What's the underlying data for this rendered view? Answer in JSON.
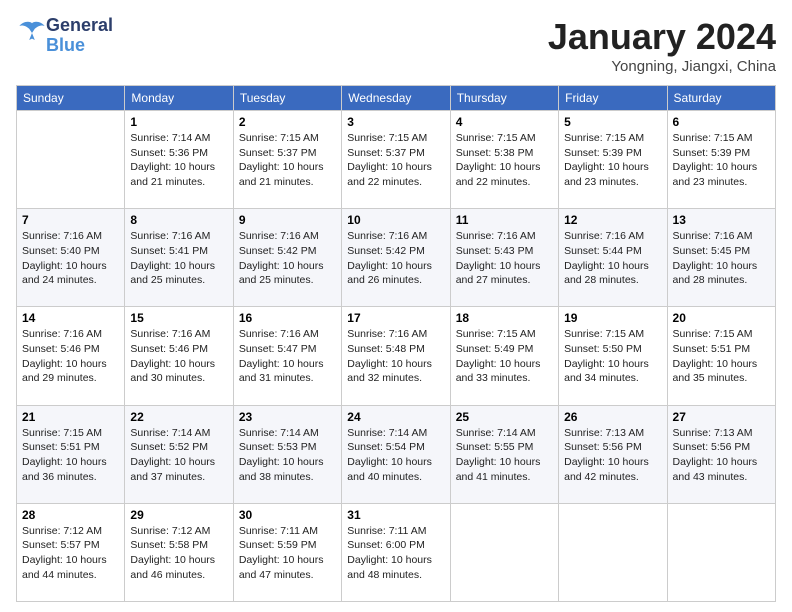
{
  "header": {
    "logo_line1": "General",
    "logo_line2": "Blue",
    "month_title": "January 2024",
    "location": "Yongning, Jiangxi, China"
  },
  "days_of_week": [
    "Sunday",
    "Monday",
    "Tuesday",
    "Wednesday",
    "Thursday",
    "Friday",
    "Saturday"
  ],
  "weeks": [
    [
      {
        "day": "",
        "info": ""
      },
      {
        "day": "1",
        "info": "Sunrise: 7:14 AM\nSunset: 5:36 PM\nDaylight: 10 hours\nand 21 minutes."
      },
      {
        "day": "2",
        "info": "Sunrise: 7:15 AM\nSunset: 5:37 PM\nDaylight: 10 hours\nand 21 minutes."
      },
      {
        "day": "3",
        "info": "Sunrise: 7:15 AM\nSunset: 5:37 PM\nDaylight: 10 hours\nand 22 minutes."
      },
      {
        "day": "4",
        "info": "Sunrise: 7:15 AM\nSunset: 5:38 PM\nDaylight: 10 hours\nand 22 minutes."
      },
      {
        "day": "5",
        "info": "Sunrise: 7:15 AM\nSunset: 5:39 PM\nDaylight: 10 hours\nand 23 minutes."
      },
      {
        "day": "6",
        "info": "Sunrise: 7:15 AM\nSunset: 5:39 PM\nDaylight: 10 hours\nand 23 minutes."
      }
    ],
    [
      {
        "day": "7",
        "info": "Sunrise: 7:16 AM\nSunset: 5:40 PM\nDaylight: 10 hours\nand 24 minutes."
      },
      {
        "day": "8",
        "info": "Sunrise: 7:16 AM\nSunset: 5:41 PM\nDaylight: 10 hours\nand 25 minutes."
      },
      {
        "day": "9",
        "info": "Sunrise: 7:16 AM\nSunset: 5:42 PM\nDaylight: 10 hours\nand 25 minutes."
      },
      {
        "day": "10",
        "info": "Sunrise: 7:16 AM\nSunset: 5:42 PM\nDaylight: 10 hours\nand 26 minutes."
      },
      {
        "day": "11",
        "info": "Sunrise: 7:16 AM\nSunset: 5:43 PM\nDaylight: 10 hours\nand 27 minutes."
      },
      {
        "day": "12",
        "info": "Sunrise: 7:16 AM\nSunset: 5:44 PM\nDaylight: 10 hours\nand 28 minutes."
      },
      {
        "day": "13",
        "info": "Sunrise: 7:16 AM\nSunset: 5:45 PM\nDaylight: 10 hours\nand 28 minutes."
      }
    ],
    [
      {
        "day": "14",
        "info": "Sunrise: 7:16 AM\nSunset: 5:46 PM\nDaylight: 10 hours\nand 29 minutes."
      },
      {
        "day": "15",
        "info": "Sunrise: 7:16 AM\nSunset: 5:46 PM\nDaylight: 10 hours\nand 30 minutes."
      },
      {
        "day": "16",
        "info": "Sunrise: 7:16 AM\nSunset: 5:47 PM\nDaylight: 10 hours\nand 31 minutes."
      },
      {
        "day": "17",
        "info": "Sunrise: 7:16 AM\nSunset: 5:48 PM\nDaylight: 10 hours\nand 32 minutes."
      },
      {
        "day": "18",
        "info": "Sunrise: 7:15 AM\nSunset: 5:49 PM\nDaylight: 10 hours\nand 33 minutes."
      },
      {
        "day": "19",
        "info": "Sunrise: 7:15 AM\nSunset: 5:50 PM\nDaylight: 10 hours\nand 34 minutes."
      },
      {
        "day": "20",
        "info": "Sunrise: 7:15 AM\nSunset: 5:51 PM\nDaylight: 10 hours\nand 35 minutes."
      }
    ],
    [
      {
        "day": "21",
        "info": "Sunrise: 7:15 AM\nSunset: 5:51 PM\nDaylight: 10 hours\nand 36 minutes."
      },
      {
        "day": "22",
        "info": "Sunrise: 7:14 AM\nSunset: 5:52 PM\nDaylight: 10 hours\nand 37 minutes."
      },
      {
        "day": "23",
        "info": "Sunrise: 7:14 AM\nSunset: 5:53 PM\nDaylight: 10 hours\nand 38 minutes."
      },
      {
        "day": "24",
        "info": "Sunrise: 7:14 AM\nSunset: 5:54 PM\nDaylight: 10 hours\nand 40 minutes."
      },
      {
        "day": "25",
        "info": "Sunrise: 7:14 AM\nSunset: 5:55 PM\nDaylight: 10 hours\nand 41 minutes."
      },
      {
        "day": "26",
        "info": "Sunrise: 7:13 AM\nSunset: 5:56 PM\nDaylight: 10 hours\nand 42 minutes."
      },
      {
        "day": "27",
        "info": "Sunrise: 7:13 AM\nSunset: 5:56 PM\nDaylight: 10 hours\nand 43 minutes."
      }
    ],
    [
      {
        "day": "28",
        "info": "Sunrise: 7:12 AM\nSunset: 5:57 PM\nDaylight: 10 hours\nand 44 minutes."
      },
      {
        "day": "29",
        "info": "Sunrise: 7:12 AM\nSunset: 5:58 PM\nDaylight: 10 hours\nand 46 minutes."
      },
      {
        "day": "30",
        "info": "Sunrise: 7:11 AM\nSunset: 5:59 PM\nDaylight: 10 hours\nand 47 minutes."
      },
      {
        "day": "31",
        "info": "Sunrise: 7:11 AM\nSunset: 6:00 PM\nDaylight: 10 hours\nand 48 minutes."
      },
      {
        "day": "",
        "info": ""
      },
      {
        "day": "",
        "info": ""
      },
      {
        "day": "",
        "info": ""
      }
    ]
  ]
}
